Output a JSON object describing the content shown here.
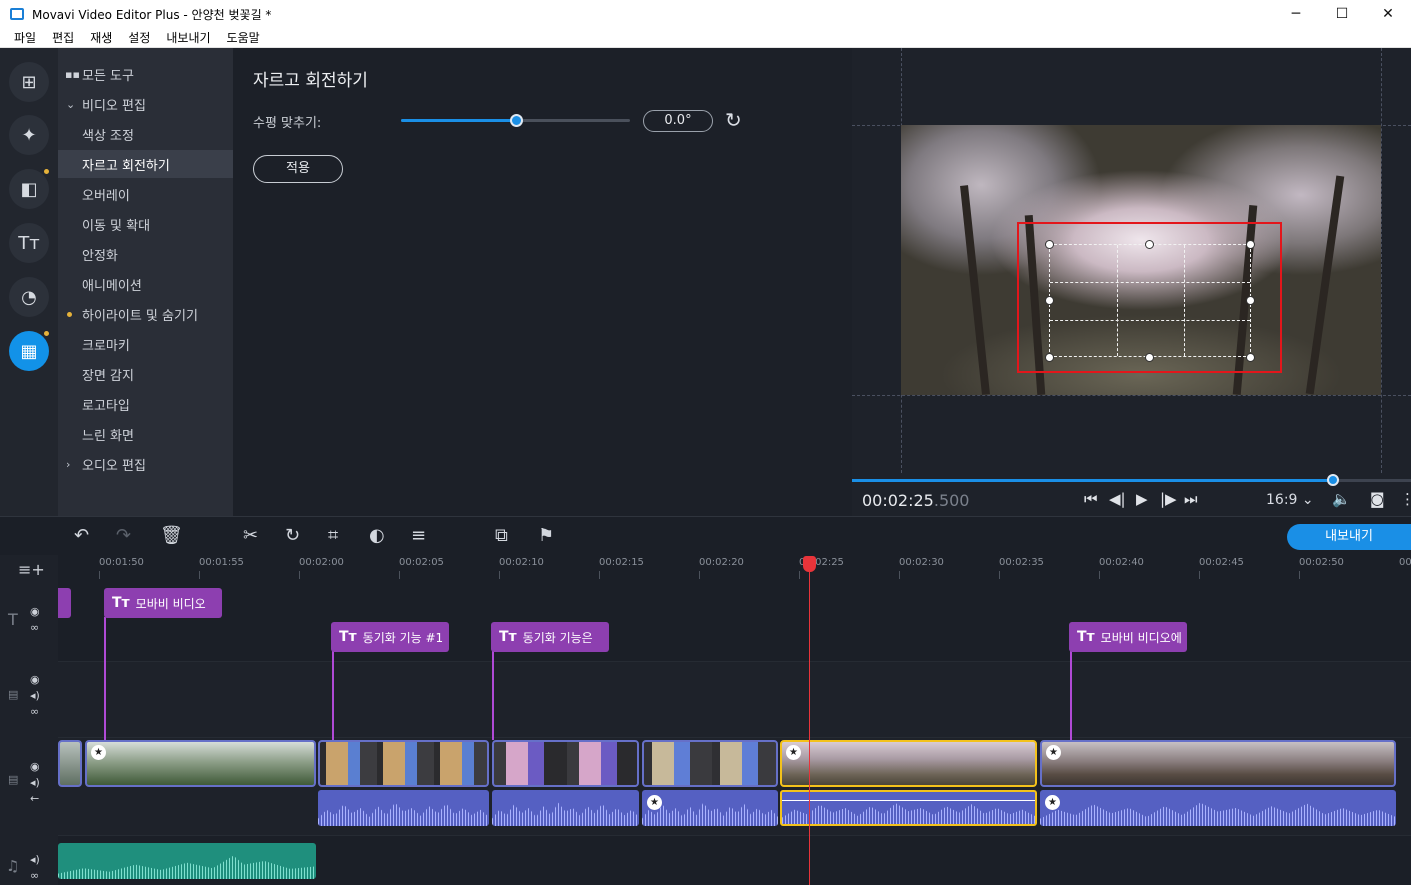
{
  "window": {
    "title": "Movavi Video Editor Plus - 안양천 벚꽃길 *",
    "min_icon": "─",
    "max_icon": "☐",
    "close_icon": "✕"
  },
  "menu": [
    "파일",
    "편집",
    "재생",
    "설정",
    "내보내기",
    "도움말"
  ],
  "rail_icons": [
    "import-icon",
    "magic-wand-icon",
    "transitions-icon",
    "titles-icon",
    "stickers-icon",
    "more-tools-icon"
  ],
  "tools_panel": {
    "all_tools": "모든 도구",
    "video_edit": "비디오 편집",
    "items": [
      "색상 조정",
      "자르고 회전하기",
      "오버레이",
      "이동 및 확대",
      "안정화",
      "애니메이션",
      "하이라이트 및 숨기기",
      "크로마키",
      "장면 감지",
      "로고타입",
      "느린 화면"
    ],
    "audio_edit": "오디오 편집",
    "active_item": "자르고 회전하기"
  },
  "settings": {
    "title": "자르고 회전하기",
    "level_label": "수평 맞추기:",
    "level_value": "0.0°",
    "slider_fraction": 0.5,
    "apply_label": "적용"
  },
  "preview": {
    "timecode_main": "00:02:25",
    "timecode_ms": ".500",
    "aspect_ratio": "16:9 ⌄",
    "progress_fraction": 0.86
  },
  "timeline": {
    "export_label": "내보내기",
    "ruler_ticks": [
      "00:01:50",
      "00:01:55",
      "00:02:00",
      "00:02:05",
      "00:02:10",
      "00:02:15",
      "00:02:20",
      "00:02:25",
      "00:02:30",
      "00:02:35",
      "00:02:40",
      "00:02:45",
      "00:02:50",
      "00:"
    ],
    "title_clips": [
      "모바비 비디오",
      "동기화 기능 #1",
      "동기화 기능은",
      "모바비 비디오에"
    ]
  },
  "colors": {
    "accent": "#1a8fe6",
    "title_clip": "#8d3fb0",
    "selected_clip": "#f3c21b",
    "playhead": "#e8343a",
    "crop_frame": "#e3161b"
  }
}
